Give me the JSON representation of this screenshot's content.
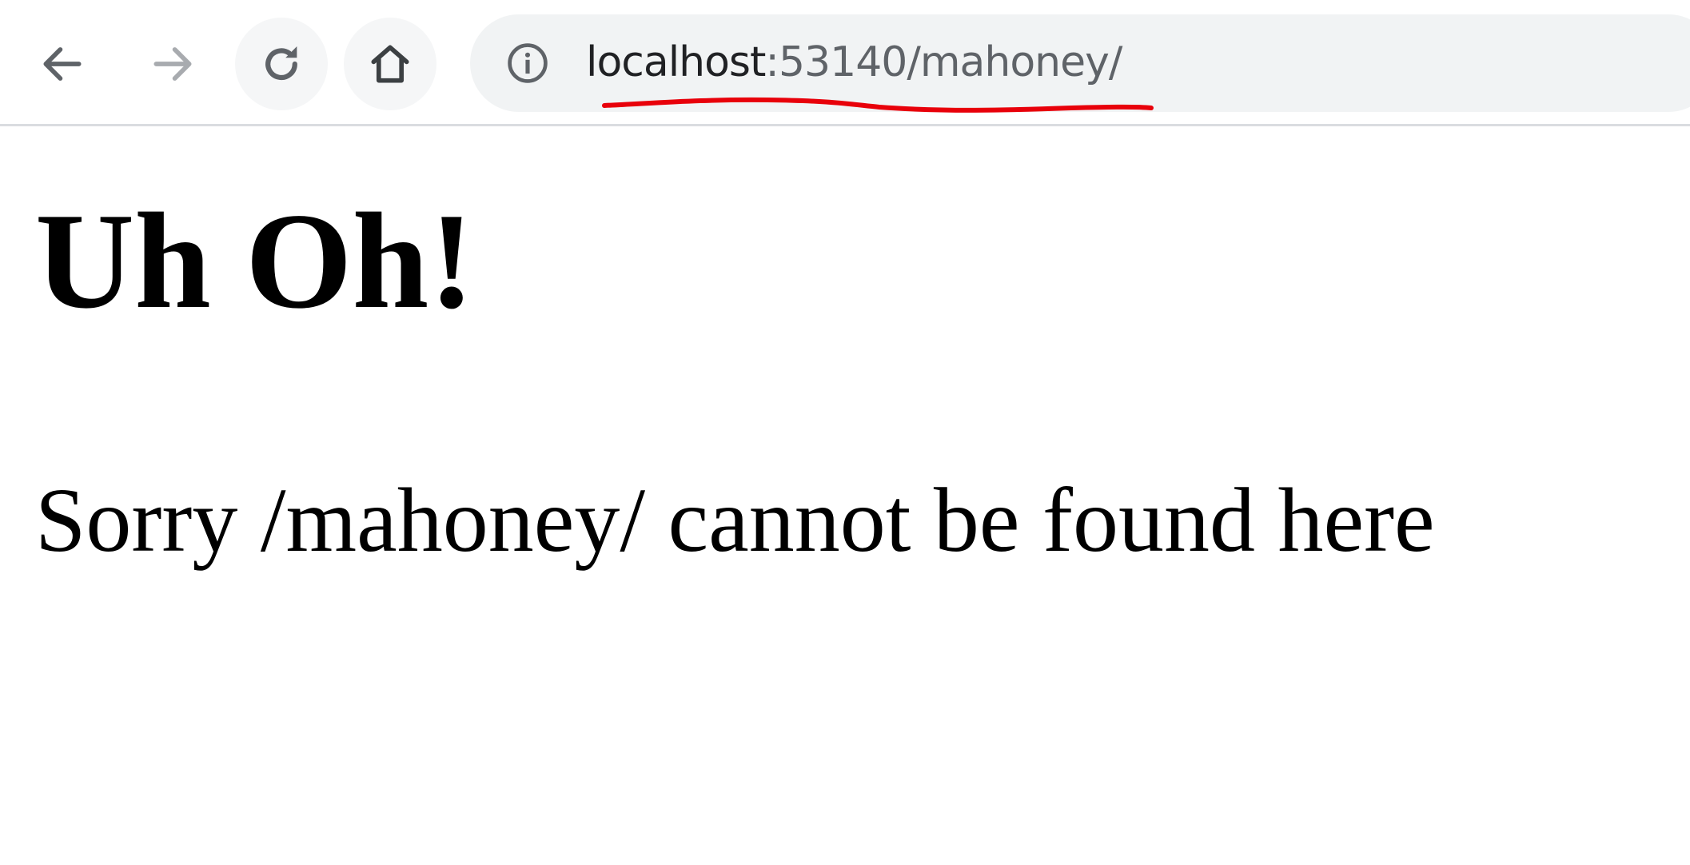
{
  "browser": {
    "nav": {
      "back_icon": "arrow-left-icon",
      "forward_icon": "arrow-right-icon",
      "reload_icon": "reload-icon",
      "home_icon": "home-icon"
    },
    "omnibox": {
      "site_info_icon": "info-circle-icon",
      "url_host": "localhost",
      "url_rest": ":53140/mahoney/"
    },
    "annotation": {
      "underline_color": "#e8000a"
    }
  },
  "page": {
    "heading": "Uh Oh!",
    "message": "Sorry /mahoney/ cannot be found here"
  },
  "colors": {
    "toolbar_bg": "#ffffff",
    "omnibox_bg": "#f1f3f4",
    "icon_active": "#5f6368",
    "icon_disabled": "#a8abaf",
    "separator": "#dadce0",
    "page_text": "#000000"
  }
}
